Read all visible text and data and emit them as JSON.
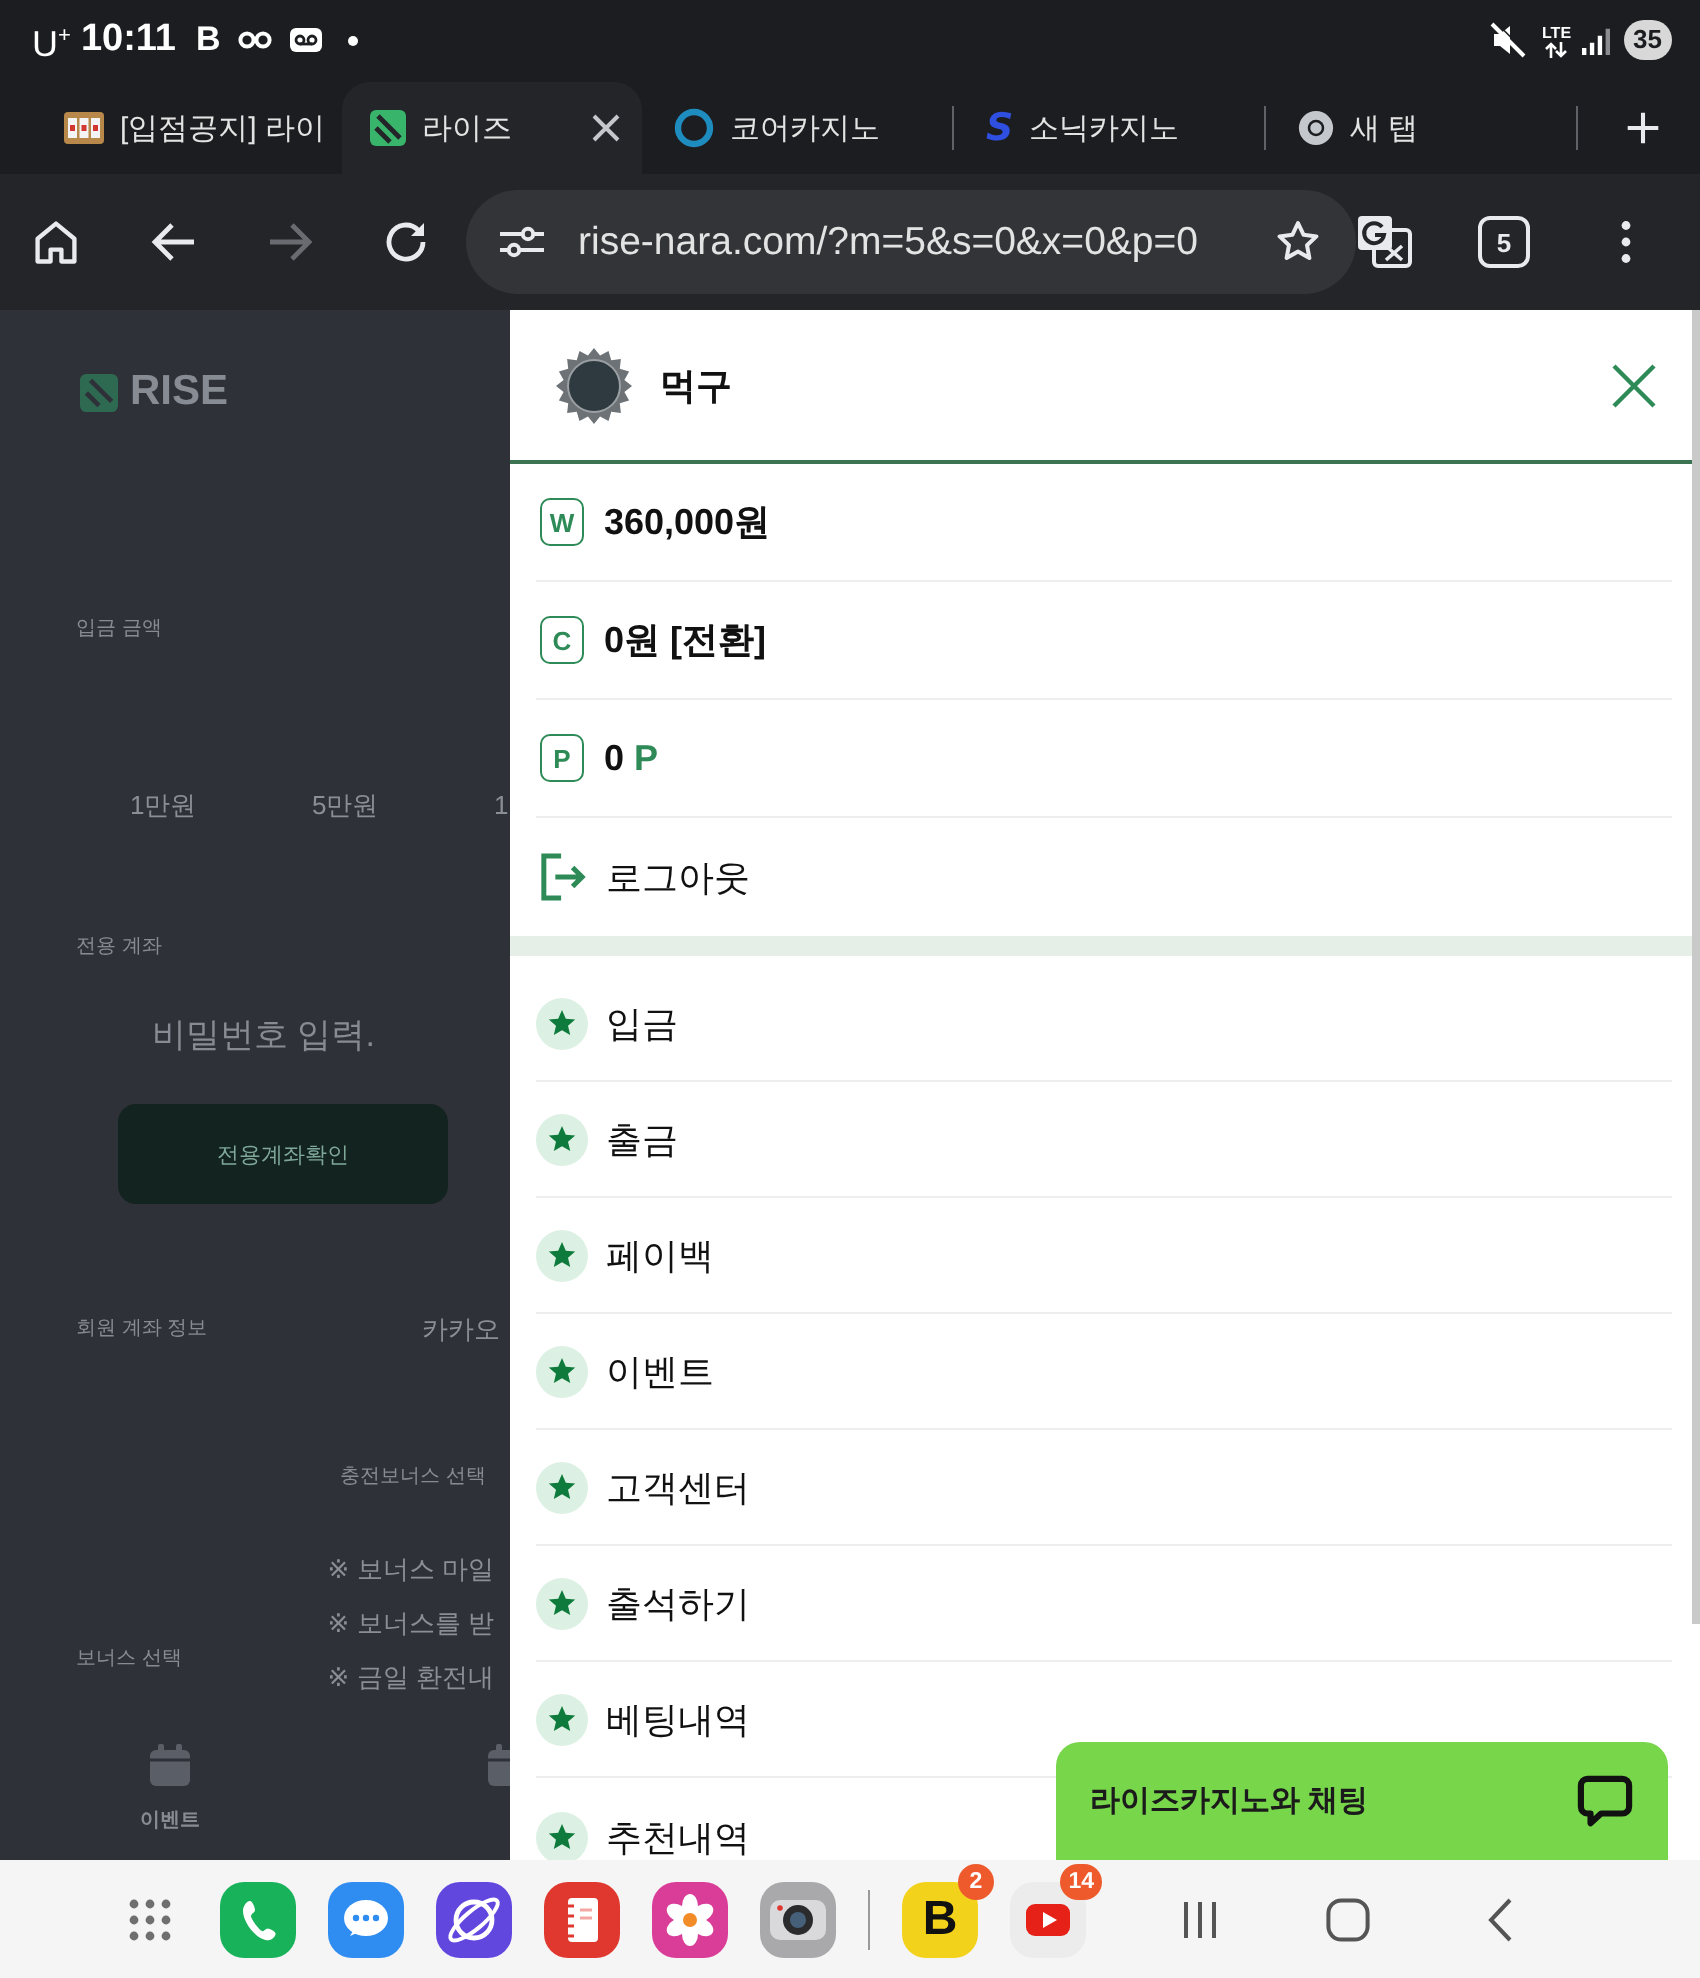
{
  "status_bar": {
    "carrier": "U$^{+}$",
    "time": "10:11",
    "notifications": [
      {
        "kind": "letter",
        "letter": "B"
      },
      {
        "kind": "infinity"
      },
      {
        "kind": "voicemail"
      },
      {
        "kind": "dot"
      }
    ],
    "network": "LTE",
    "battery": "35"
  },
  "tabs": [
    {
      "title": "[입점공지] 라이",
      "kind": "slots",
      "selected": false
    },
    {
      "title": "라이즈",
      "kind": "striped",
      "selected": true
    },
    {
      "title": "코어카지노",
      "kind": "ring",
      "selected": false
    },
    {
      "title": "소닉카지노",
      "kind": "letter",
      "letter": "S",
      "selected": false
    },
    {
      "title": "새 탭",
      "kind": "browser",
      "selected": false
    }
  ],
  "toolbar": {
    "forward_disabled": true,
    "url": "rise-nara.com/?m=5&s=0&x=0&p=0",
    "tab_count": "5"
  },
  "page": {
    "logo": "RISE",
    "deposit_label": "입금 금액",
    "amounts": [
      "1만원",
      "5만원",
      "1"
    ],
    "account_label": "전용 계좌",
    "password_placeholder": "비밀번호 입력.",
    "confirm_button": "전용계좌확인",
    "member_account_label": "회원 계좌 정보",
    "member_account_value": "카카오",
    "bonus_title": "충전보너스 선택",
    "bonus_label": "보너스 선택",
    "notes": [
      "※ 보너스 마일",
      "※ 보너스를 받",
      "※ 금일 환전내"
    ],
    "bottom_nav": [
      {
        "label": "이벤트"
      }
    ]
  },
  "drawer": {
    "user_name": "먹구",
    "balances": [
      {
        "kind": "wallet",
        "letter": "W",
        "value": "360,000원"
      },
      {
        "kind": "wallet",
        "letter": "C",
        "value": "0원 [전환]"
      },
      {
        "kind": "wallet",
        "letter": "P",
        "value": "0",
        "unit": "P"
      },
      {
        "kind": "logout",
        "value": "로그아웃"
      }
    ],
    "menu": [
      "입금",
      "출금",
      "페이백",
      "이벤트",
      "고객센터",
      "출석하기",
      "베팅내역",
      "추천내역"
    ]
  },
  "chat_button": {
    "label": "라이즈카지노와 채팅"
  },
  "dock": {
    "apps": [
      {
        "kind": "apps-grid"
      },
      {
        "kind": "phone"
      },
      {
        "kind": "messages"
      },
      {
        "kind": "internet"
      },
      {
        "kind": "notes"
      },
      {
        "kind": "gallery"
      },
      {
        "kind": "camera"
      },
      {
        "kind": "divider"
      },
      {
        "kind": "letter",
        "letter": "B",
        "badge": "2"
      },
      {
        "kind": "video",
        "badge": "14"
      }
    ],
    "nav": [
      {
        "kind": "recents"
      },
      {
        "kind": "home"
      },
      {
        "kind": "back"
      }
    ]
  }
}
